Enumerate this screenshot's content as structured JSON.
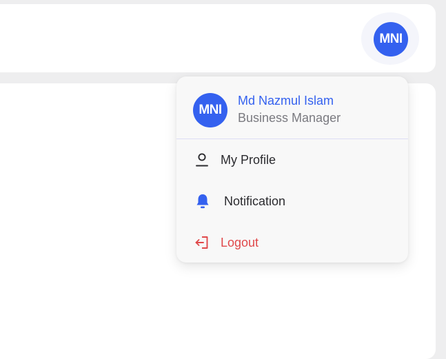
{
  "header": {
    "avatar_initials": "MNI"
  },
  "user_menu": {
    "avatar_initials": "MNI",
    "name": "Md Nazmul Islam",
    "role": "Business Manager",
    "items": [
      {
        "label": "My Profile",
        "icon": "user-icon"
      },
      {
        "label": "Notification",
        "icon": "bell-icon"
      },
      {
        "label": "Logout",
        "icon": "logout-icon"
      }
    ]
  },
  "colors": {
    "accent": "#3461ef",
    "danger": "#e0484a"
  }
}
